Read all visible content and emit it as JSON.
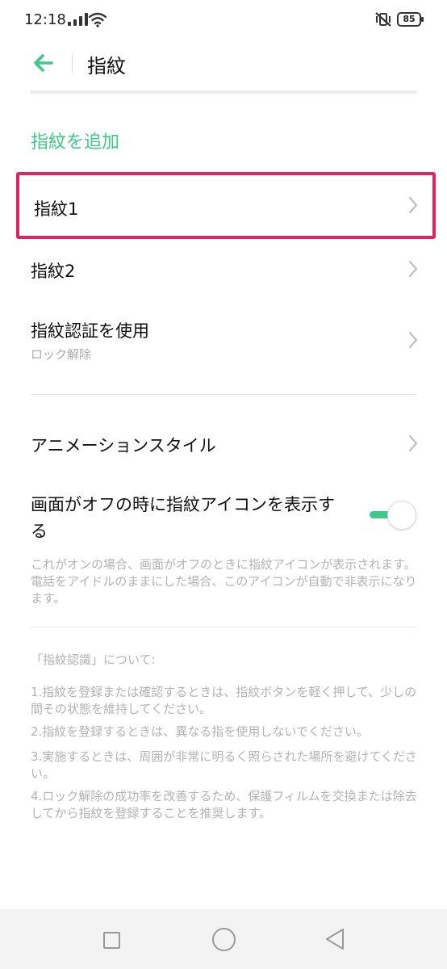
{
  "status": {
    "time": "12:18",
    "battery": "85"
  },
  "header": {
    "title": "指紋"
  },
  "settings": {
    "add_fingerprint": "指紋を追加",
    "fingerprint1": "指紋1",
    "fingerprint2": "指紋2",
    "use_auth": "指紋認証を使用",
    "use_auth_sub": "ロック解除",
    "animation_style": "アニメーションスタイル",
    "show_icon_label": "画面がオフの時に指紋アイコンを表示する",
    "show_icon_enabled": true,
    "show_icon_desc": "これがオンの場合、画面がオフのときに指紋アイコンが表示されます。電話をアイドルのままにした場合、このアイコンが自動で非表示になります。"
  },
  "about": {
    "title": "「指紋認識」について:",
    "items": [
      "1.指紋を登録または確認するときは、指紋ボタンを軽く押して、少しの間その状態を維持してください。",
      "2.指紋を登録するときは、異なる指を使用しないでください。",
      "3.実施するときは、周囲が非常に明るく照らされた場所を避けてください。",
      "4.ロック解除の成功率を改善するため、保護フィルムを交換または除去してから指紋を登録することを推奨します。"
    ]
  },
  "colors": {
    "accent": "#3ec98a",
    "highlight": "#e0245e"
  },
  "icons": {
    "back": "arrow-left-icon",
    "chevron": "chevron-right-icon",
    "wifi": "wifi-icon",
    "signal": "signal-icon",
    "mute": "vibrate-off-icon",
    "battery": "battery-icon",
    "nav_recents": "square-icon",
    "nav_home": "circle-icon",
    "nav_back": "triangle-back-icon"
  }
}
